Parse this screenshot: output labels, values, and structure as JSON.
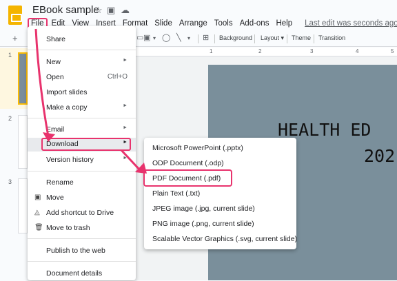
{
  "header": {
    "title": "EBook sample",
    "menus": [
      "File",
      "Edit",
      "View",
      "Insert",
      "Format",
      "Slide",
      "Arrange",
      "Tools",
      "Add-ons",
      "Help"
    ],
    "last_edit": "Last edit was seconds ago"
  },
  "toolbar": {
    "background": "Background",
    "layout": "Layout",
    "theme": "Theme",
    "transition": "Transition"
  },
  "ruler": [
    "1",
    "2",
    "3",
    "4",
    "5"
  ],
  "slides": {
    "numbers": [
      "1",
      "2",
      "3"
    ]
  },
  "slide_text": {
    "line1": "HEALTH ED",
    "line2": "202"
  },
  "file_menu": {
    "share": "Share",
    "new": "New",
    "open": "Open",
    "open_shortcut": "Ctrl+O",
    "import_slides": "Import slides",
    "make_a_copy": "Make a copy",
    "email": "Email",
    "download": "Download",
    "version_history": "Version history",
    "rename": "Rename",
    "move": "Move",
    "add_shortcut": "Add shortcut to Drive",
    "move_to_trash": "Move to trash",
    "publish": "Publish to the web",
    "document_details": "Document details"
  },
  "download_menu": [
    "Microsoft PowerPoint (.pptx)",
    "ODP Document (.odp)",
    "PDF Document (.pdf)",
    "Plain Text (.txt)",
    "JPEG image (.jpg, current slide)",
    "PNG image (.png, current slide)",
    "Scalable Vector Graphics (.svg, current slide)"
  ],
  "colors": {
    "highlight": "#e8336d",
    "slide_bg": "#7a8f9b",
    "app_yellow": "#f4b400"
  }
}
